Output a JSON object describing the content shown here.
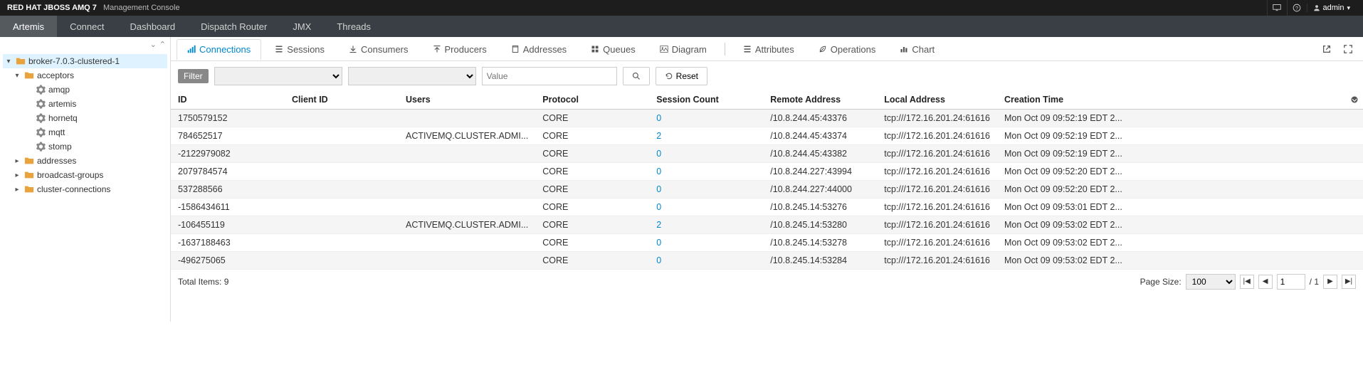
{
  "topbar": {
    "brand_bold": "RED HAT JBOSS AMQ 7",
    "brand_light": "Management Console",
    "user": "admin"
  },
  "mainnav": [
    {
      "label": "Artemis",
      "active": true
    },
    {
      "label": "Connect",
      "active": false
    },
    {
      "label": "Dashboard",
      "active": false
    },
    {
      "label": "Dispatch Router",
      "active": false
    },
    {
      "label": "JMX",
      "active": false
    },
    {
      "label": "Threads",
      "active": false
    }
  ],
  "tree": {
    "root": {
      "label": "broker-7.0.3-clustered-1",
      "expanded": true,
      "selected": true,
      "icon": "folder",
      "indent": 0
    },
    "children": [
      {
        "label": "acceptors",
        "expanded": true,
        "icon": "folder",
        "indent": 1,
        "children": [
          {
            "label": "amqp",
            "icon": "gear",
            "indent": 2
          },
          {
            "label": "artemis",
            "icon": "gear",
            "indent": 2
          },
          {
            "label": "hornetq",
            "icon": "gear",
            "indent": 2
          },
          {
            "label": "mqtt",
            "icon": "gear",
            "indent": 2
          },
          {
            "label": "stomp",
            "icon": "gear",
            "indent": 2
          }
        ]
      },
      {
        "label": "addresses",
        "expanded": false,
        "icon": "folder",
        "indent": 1
      },
      {
        "label": "broadcast-groups",
        "expanded": false,
        "icon": "folder",
        "indent": 1
      },
      {
        "label": "cluster-connections",
        "expanded": false,
        "icon": "folder",
        "indent": 1
      }
    ]
  },
  "tabs_left": [
    {
      "label": "Connections",
      "icon": "signal",
      "active": true
    },
    {
      "label": "Sessions",
      "icon": "list",
      "active": false
    },
    {
      "label": "Consumers",
      "icon": "download",
      "active": false
    },
    {
      "label": "Producers",
      "icon": "upload",
      "active": false
    },
    {
      "label": "Addresses",
      "icon": "book",
      "active": false
    },
    {
      "label": "Queues",
      "icon": "grid",
      "active": false
    },
    {
      "label": "Diagram",
      "icon": "picture",
      "active": false
    }
  ],
  "tabs_right": [
    {
      "label": "Attributes",
      "icon": "list",
      "active": false
    },
    {
      "label": "Operations",
      "icon": "leaf",
      "active": false
    },
    {
      "label": "Chart",
      "icon": "bar",
      "active": false
    }
  ],
  "filter": {
    "label": "Filter",
    "value_placeholder": "Value",
    "reset": "Reset"
  },
  "columns": [
    "ID",
    "Client ID",
    "Users",
    "Protocol",
    "Session Count",
    "Remote Address",
    "Local Address",
    "Creation Time"
  ],
  "rows": [
    {
      "id": "1750579152",
      "client": "",
      "users": "",
      "proto": "CORE",
      "sess": "0",
      "remote": "/10.8.244.45:43376",
      "local": "tcp:///172.16.201.24:61616",
      "time": "Mon Oct 09 09:52:19 EDT 2..."
    },
    {
      "id": "784652517",
      "client": "",
      "users": "ACTIVEMQ.CLUSTER.ADMI...",
      "proto": "CORE",
      "sess": "2",
      "remote": "/10.8.244.45:43374",
      "local": "tcp:///172.16.201.24:61616",
      "time": "Mon Oct 09 09:52:19 EDT 2..."
    },
    {
      "id": "-2122979082",
      "client": "",
      "users": "",
      "proto": "CORE",
      "sess": "0",
      "remote": "/10.8.244.45:43382",
      "local": "tcp:///172.16.201.24:61616",
      "time": "Mon Oct 09 09:52:19 EDT 2..."
    },
    {
      "id": "2079784574",
      "client": "",
      "users": "",
      "proto": "CORE",
      "sess": "0",
      "remote": "/10.8.244.227:43994",
      "local": "tcp:///172.16.201.24:61616",
      "time": "Mon Oct 09 09:52:20 EDT 2..."
    },
    {
      "id": "537288566",
      "client": "",
      "users": "",
      "proto": "CORE",
      "sess": "0",
      "remote": "/10.8.244.227:44000",
      "local": "tcp:///172.16.201.24:61616",
      "time": "Mon Oct 09 09:52:20 EDT 2..."
    },
    {
      "id": "-1586434611",
      "client": "",
      "users": "",
      "proto": "CORE",
      "sess": "0",
      "remote": "/10.8.245.14:53276",
      "local": "tcp:///172.16.201.24:61616",
      "time": "Mon Oct 09 09:53:01 EDT 2..."
    },
    {
      "id": "-106455119",
      "client": "",
      "users": "ACTIVEMQ.CLUSTER.ADMI...",
      "proto": "CORE",
      "sess": "2",
      "remote": "/10.8.245.14:53280",
      "local": "tcp:///172.16.201.24:61616",
      "time": "Mon Oct 09 09:53:02 EDT 2..."
    },
    {
      "id": "-1637188463",
      "client": "",
      "users": "",
      "proto": "CORE",
      "sess": "0",
      "remote": "/10.8.245.14:53278",
      "local": "tcp:///172.16.201.24:61616",
      "time": "Mon Oct 09 09:53:02 EDT 2..."
    },
    {
      "id": "-496275065",
      "client": "",
      "users": "",
      "proto": "CORE",
      "sess": "0",
      "remote": "/10.8.245.14:53284",
      "local": "tcp:///172.16.201.24:61616",
      "time": "Mon Oct 09 09:53:02 EDT 2..."
    }
  ],
  "footer": {
    "total_label": "Total Items: 9",
    "page_size_label": "Page Size:",
    "page_size": "100",
    "page": "1",
    "page_total": "/ 1"
  }
}
